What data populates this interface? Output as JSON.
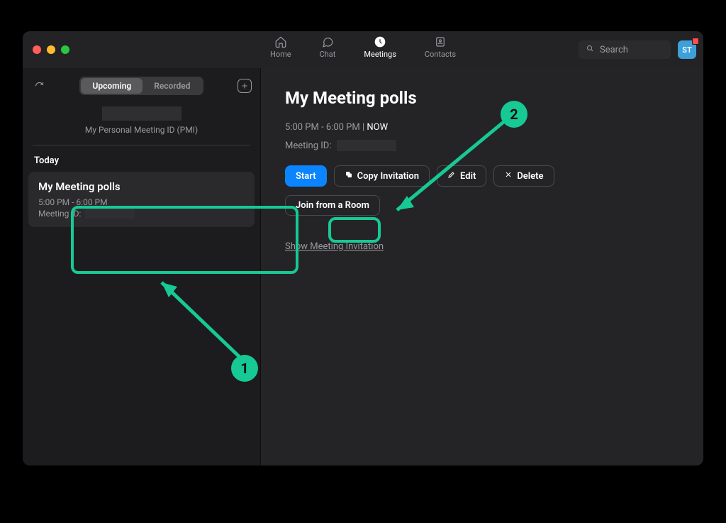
{
  "nav": {
    "home": "Home",
    "chat": "Chat",
    "meetings": "Meetings",
    "contacts": "Contacts"
  },
  "search": {
    "placeholder": "Search"
  },
  "avatar": {
    "initials": "ST"
  },
  "sidebar": {
    "segment": {
      "upcoming": "Upcoming",
      "recorded": "Recorded"
    },
    "pmi_label": "My Personal Meeting ID (PMI)",
    "today_label": "Today",
    "meeting": {
      "title": "My Meeting polls",
      "time": "5:00 PM - 6:00 PM",
      "id_label": "Meeting ID:"
    }
  },
  "detail": {
    "title": "My Meeting polls",
    "time": "5:00 PM - 6:00 PM",
    "now_separator": "  |  ",
    "now": "NOW",
    "id_label": "Meeting ID:",
    "buttons": {
      "start": "Start",
      "copy": "Copy Invitation",
      "edit": "Edit",
      "delete": "Delete",
      "join_room": "Join from a Room"
    },
    "show_invite": "Show Meeting Invitation"
  },
  "annotations": {
    "one": "1",
    "two": "2"
  }
}
